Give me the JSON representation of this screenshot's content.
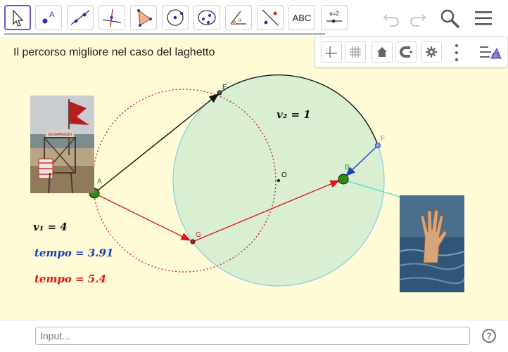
{
  "toolbar": {
    "tools": [
      {
        "name": "move-tool-icon"
      },
      {
        "name": "point-tool-icon"
      },
      {
        "name": "line-tool-icon"
      },
      {
        "name": "perpendicular-tool-icon"
      },
      {
        "name": "polygon-tool-icon"
      },
      {
        "name": "circle-tool-icon"
      },
      {
        "name": "ellipse-tool-icon"
      },
      {
        "name": "angle-tool-icon"
      },
      {
        "name": "reflect-tool-icon"
      },
      {
        "name": "text-tool-icon",
        "label": "ABC"
      },
      {
        "name": "slider-tool-icon",
        "label": "a=2"
      }
    ],
    "undo_icon": "undo-icon",
    "redo_icon": "redo-icon",
    "search_icon": "search-icon",
    "menu_icon": "menu-icon",
    "accent": "#6557d2"
  },
  "stylebar": {
    "buttons": [
      "axes-icon",
      "grid-icon",
      "home-icon",
      "magnet-icon",
      "gear-icon",
      "more-icon",
      "view-toggle-icon"
    ]
  },
  "canvas": {
    "heading": "Il percorso migliore nel caso del laghetto",
    "background": "#fffbd6",
    "v2_label": "v₂ = 1",
    "v1_label": "v₁ = 4",
    "tempo_blue": "tempo = 3.91",
    "tempo_red": "tempo = 5.4",
    "points": {
      "A": "A",
      "B": "B",
      "E": "E",
      "F": "F",
      "G": "G",
      "O": "O"
    },
    "colors": {
      "lake_fill": "#d4ecd0",
      "lake_stroke": "#7ecfe8",
      "red": "#e0161a",
      "blue": "#1c3fbf",
      "green": "#2e8b1a",
      "cyan": "#4fe3d0",
      "dotted_circle": "#cc1818"
    }
  },
  "footer": {
    "input_placeholder": "Input...",
    "help_label": "?"
  }
}
